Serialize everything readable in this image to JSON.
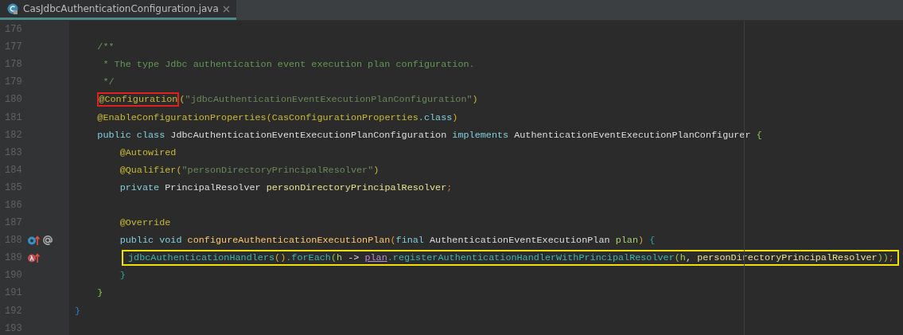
{
  "tab": {
    "label": "CasJdbcAuthenticationConfiguration.java",
    "selected": true
  },
  "lines": [
    {
      "number": "176"
    },
    {
      "number": "177",
      "tokens": [
        {
          "text": "    /**",
          "kind": "comment"
        }
      ]
    },
    {
      "number": "178",
      "tokens": [
        {
          "text": "     * The type Jdbc authentication event execution plan configuration.",
          "kind": "comment"
        }
      ]
    },
    {
      "number": "179",
      "tokens": [
        {
          "text": "     */",
          "kind": "comment"
        }
      ]
    },
    {
      "number": "180",
      "tokens": [
        {
          "text": "    @Configuration",
          "kind": "annotation",
          "highlighted": true
        },
        {
          "text": "(",
          "kind": "annotation"
        },
        {
          "text": "\"jdbcAuthenticationEventExecutionPlanConfiguration\"",
          "kind": "string"
        },
        {
          "text": ")",
          "kind": "annotation"
        }
      ]
    },
    {
      "number": "181",
      "tokens": [
        {
          "text": "    @EnableConfigurationProperties",
          "kind": "annotation"
        },
        {
          "text": "(",
          "kind": "paren_yellow"
        },
        {
          "text": "CasConfigurationProperties",
          "kind": "annotation"
        },
        {
          "text": ".class",
          "kind": "keyword"
        },
        {
          "text": ")",
          "kind": "paren_yellow"
        }
      ]
    },
    {
      "number": "182",
      "tokens": [
        {
          "text": "    public class ",
          "kind": "keyword"
        },
        {
          "text": "JdbcAuthenticationEventExecutionPlanConfiguration ",
          "kind": "type"
        },
        {
          "text": "implements ",
          "kind": "keyword"
        },
        {
          "text": "AuthenticationEventExecutionPlanConfigurer ",
          "kind": "type"
        },
        {
          "text": "{",
          "kind": "paren_green"
        }
      ]
    },
    {
      "number": "183",
      "tokens": [
        {
          "text": "        @Autowired",
          "kind": "annotation"
        }
      ]
    },
    {
      "number": "184",
      "tokens": [
        {
          "text": "        @Qualifier",
          "kind": "annotation"
        },
        {
          "text": "(",
          "kind": "annotation"
        },
        {
          "text": "\"personDirectoryPrincipalResolver\"",
          "kind": "string"
        },
        {
          "text": ")",
          "kind": "annotation"
        }
      ]
    },
    {
      "number": "185",
      "tokens": [
        {
          "text": "        private ",
          "kind": "keyword"
        },
        {
          "text": "PrincipalResolver ",
          "kind": "type"
        },
        {
          "text": "personDirectoryPrincipalResolver",
          "kind": "field"
        },
        {
          "text": ";",
          "kind": "semicolon"
        }
      ]
    },
    {
      "number": "186"
    },
    {
      "number": "187",
      "tokens": [
        {
          "text": "        @Override",
          "kind": "annotation"
        }
      ]
    },
    {
      "number": "188",
      "gutter_icons": [
        {
          "kind": "overrides"
        },
        {
          "kind": "annotated"
        }
      ],
      "tokens": [
        {
          "text": "        public void ",
          "kind": "keyword"
        },
        {
          "text": "configureAuthenticationExecutionPlan",
          "kind": "method"
        },
        {
          "text": "(",
          "kind": "paren_orange"
        },
        {
          "text": "final ",
          "kind": "keyword"
        },
        {
          "text": "AuthenticationEventExecutionPlan ",
          "kind": "type"
        },
        {
          "text": "plan",
          "kind": "param"
        },
        {
          "text": ") ",
          "kind": "paren_orange"
        },
        {
          "text": "{",
          "kind": "paren_teal"
        }
      ]
    },
    {
      "number": "189",
      "highlighted": true,
      "gutter_icons": [
        {
          "kind": "lambda"
        }
      ],
      "tokens": [
        {
          "text": "jdbcAuthenticationHandlers",
          "kind": "call"
        },
        {
          "text": "()",
          "kind": "paren_yellow"
        },
        {
          "text": ".forEach",
          "kind": "call"
        },
        {
          "text": "(",
          "kind": "paren_green"
        },
        {
          "text": "h ",
          "kind": "param"
        },
        {
          "text": "-> ",
          "kind": "type"
        },
        {
          "text": "plan",
          "kind": "param_ref"
        },
        {
          "text": ".registerAuthenticationHandlerWithPrincipalResolver",
          "kind": "call"
        },
        {
          "text": "(",
          "kind": "paren_green"
        },
        {
          "text": "h",
          "kind": "param"
        },
        {
          "text": ", ",
          "kind": "type"
        },
        {
          "text": "personDirectoryPrincipalResolver",
          "kind": "field"
        },
        {
          "text": "))",
          "kind": "paren_green"
        },
        {
          "text": ";",
          "kind": "semicolon"
        }
      ]
    },
    {
      "number": "190",
      "tokens": [
        {
          "text": "        }",
          "kind": "paren_teal"
        }
      ]
    },
    {
      "number": "191",
      "tokens": [
        {
          "text": "    }",
          "kind": "paren_green"
        }
      ]
    },
    {
      "number": "192",
      "tokens": [
        {
          "text": "}",
          "kind": "paren_blue"
        }
      ]
    },
    {
      "number": "193"
    }
  ]
}
